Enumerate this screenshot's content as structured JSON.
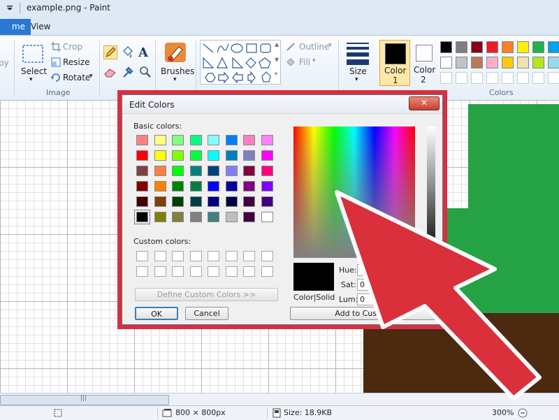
{
  "window": {
    "title": "example.png - Paint"
  },
  "tabs": [
    {
      "label": "me"
    },
    {
      "label": "View"
    }
  ],
  "ribbon": {
    "clipboard_partial": "py",
    "image": {
      "select": "Select",
      "crop": "Crop",
      "resize": "Resize",
      "rotate": "Rotate",
      "group": "Image"
    },
    "tools_group": "",
    "brushes": "Brushes",
    "shapes": {
      "outline": "Outline",
      "fill": "Fill"
    },
    "size": "Size",
    "color1": {
      "line1": "Color",
      "line2": "1"
    },
    "color2": {
      "line1": "Color",
      "line2": "2"
    },
    "colors_group": "Colors",
    "palette_row1": [
      "#000000",
      "#7f7f7f",
      "#880015",
      "#ed1c24",
      "#ff7f27",
      "#fff200",
      "#22b14c",
      "#00a2e8"
    ],
    "palette_row2": [
      "#ffffff",
      "#c3c3c3",
      "#b97a57",
      "#ffaec9",
      "#ffc90e",
      "#efe4b0",
      "#b5e61d",
      "#99d9ea"
    ]
  },
  "status": {
    "dimensions": "800 × 800px",
    "size": "Size: 18.9KB",
    "zoom": "300%"
  },
  "dialog": {
    "title": "Edit Colors",
    "close": "✕",
    "basic_colors_label": "Basic colors:",
    "custom_colors_label": "Custom colors:",
    "define_custom": "Define Custom Colors >>",
    "ok": "OK",
    "cancel": "Cancel",
    "color_solid": "Color|Solid",
    "hue_label": "Hue:",
    "sat_label": "Sat:",
    "lum_label": "Lum:",
    "sat_value": "0",
    "lum_value": "0",
    "add_custom": "Add to Custom",
    "basic_colors": [
      "#ff8080",
      "#ffff80",
      "#80ff80",
      "#00ff80",
      "#80ffff",
      "#0080ff",
      "#ff80c0",
      "#ff80ff",
      "#ff0000",
      "#ffff00",
      "#80ff00",
      "#00ff40",
      "#00ffff",
      "#0080c0",
      "#8080c0",
      "#ff00ff",
      "#804040",
      "#ff8040",
      "#00ff00",
      "#008080",
      "#004080",
      "#8080ff",
      "#800040",
      "#ff0080",
      "#800000",
      "#ff8000",
      "#008000",
      "#008040",
      "#0000ff",
      "#0000a0",
      "#800080",
      "#8000ff",
      "#400000",
      "#804000",
      "#004000",
      "#004040",
      "#000080",
      "#000040",
      "#400040",
      "#400080",
      "#000000",
      "#808000",
      "#808040",
      "#808080",
      "#408080",
      "#c0c0c0",
      "#400040",
      "#ffffff"
    ]
  }
}
